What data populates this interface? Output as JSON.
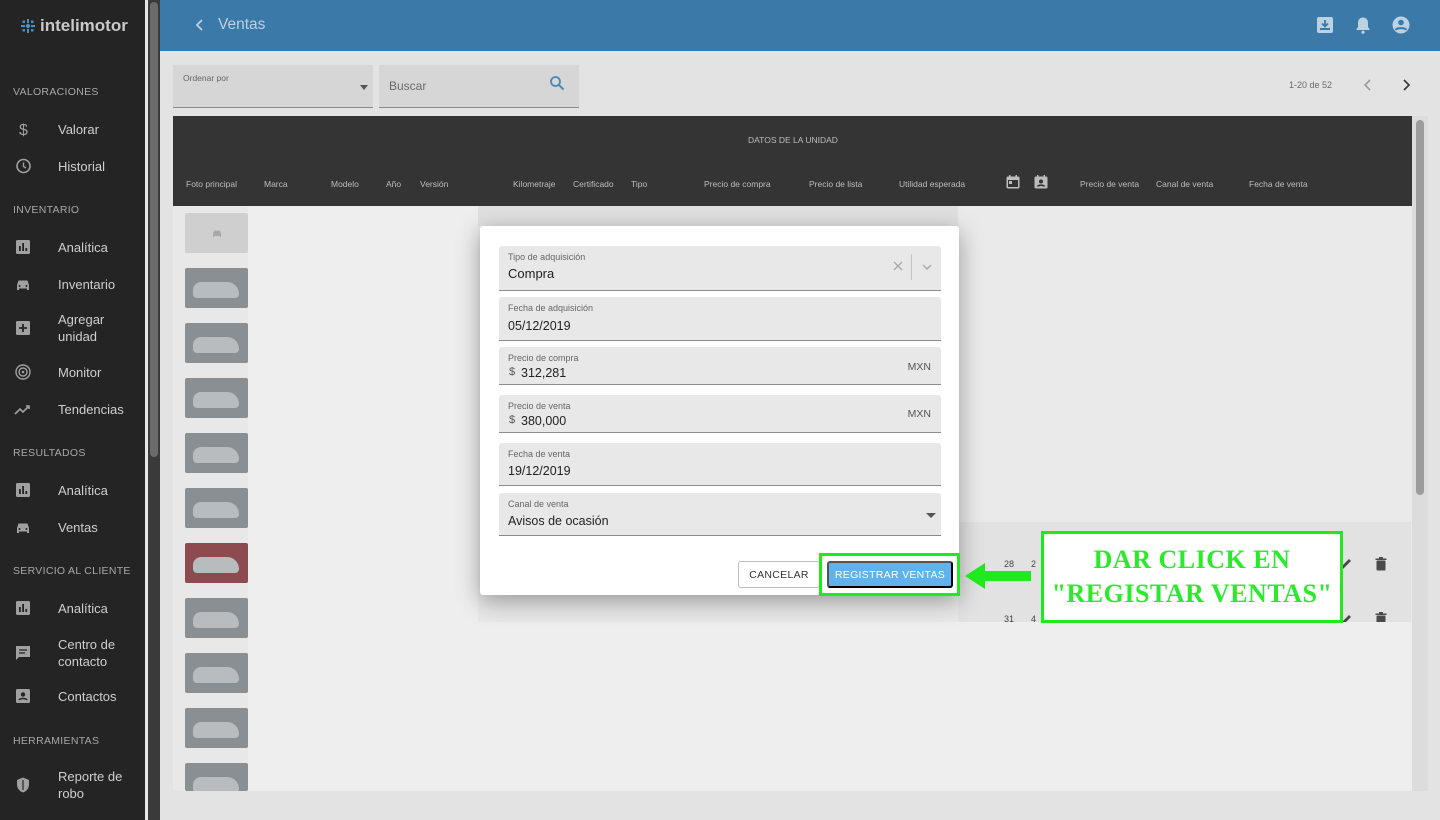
{
  "app": {
    "logo_text": "intelimotor"
  },
  "header": {
    "title": "Ventas"
  },
  "sidebar": {
    "sections": [
      {
        "title": "VALORACIONES"
      },
      {
        "title": "INVENTARIO"
      },
      {
        "title": "RESULTADOS"
      },
      {
        "title": "SERVICIO AL CLIENTE"
      },
      {
        "title": "HERRAMIENTAS"
      }
    ],
    "items": [
      {
        "label": "Valorar",
        "icon": "dollar-icon"
      },
      {
        "label": "Historial",
        "icon": "history-icon"
      },
      {
        "label": "Analítica",
        "icon": "chart-icon"
      },
      {
        "label": "Inventario",
        "icon": "car-icon"
      },
      {
        "label": "Agregar\nunidad",
        "icon": "add-box-icon"
      },
      {
        "label": "Monitor",
        "icon": "radar-icon"
      },
      {
        "label": "Tendencias",
        "icon": "trending-icon"
      },
      {
        "label": "Analítica",
        "icon": "chart-icon"
      },
      {
        "label": "Ventas",
        "icon": "car-icon"
      },
      {
        "label": "Analítica",
        "icon": "chart-icon"
      },
      {
        "label": "Centro de\ncontacto",
        "icon": "message-icon"
      },
      {
        "label": "Contactos",
        "icon": "contacts-icon"
      },
      {
        "label": "Reporte de\nrobo",
        "icon": "shield-icon"
      }
    ]
  },
  "toolbar": {
    "sort_label": "Ordenar por",
    "search_placeholder": "Buscar",
    "pagination": "1-20 de 52"
  },
  "table": {
    "group_header": "DATOS DE LA UNIDAD",
    "columns": [
      "Foto principal",
      "Marca",
      "Modelo",
      "Año",
      "Versión",
      "Kilometraje",
      "Certificado",
      "Tipo",
      "Precio de compra",
      "Precio de lista",
      "Utilidad esperada",
      "Precio de venta",
      "Canal de venta",
      "Fecha de venta"
    ],
    "row_fragments": [
      "28",
      "2",
      "31",
      "4"
    ]
  },
  "modal": {
    "fields": [
      {
        "label": "Tipo de adquisición",
        "value": "Compra"
      },
      {
        "label": "Fecha de adquisición",
        "value": "05/12/2019"
      },
      {
        "label": "Precio de compra",
        "prefix": "$",
        "value": "312,281",
        "suffix": "MXN"
      },
      {
        "label": "Precio de venta",
        "prefix": "$",
        "value": "380,000",
        "suffix": "MXN"
      },
      {
        "label": "Fecha de venta",
        "value": "19/12/2019"
      },
      {
        "label": "Canal de venta",
        "value": "Avisos de ocasión"
      }
    ],
    "cancel_label": "CANCELAR",
    "submit_label": "REGISTRAR VENTAS"
  },
  "annotation": {
    "line1": "DAR CLICK EN",
    "line2": "\"REGISTAR VENTAS\"",
    "color": "#1eea1e"
  },
  "colors": {
    "header": "#3a79a8",
    "sidebar": "#242424",
    "primary_button": "#5fb2ee"
  }
}
